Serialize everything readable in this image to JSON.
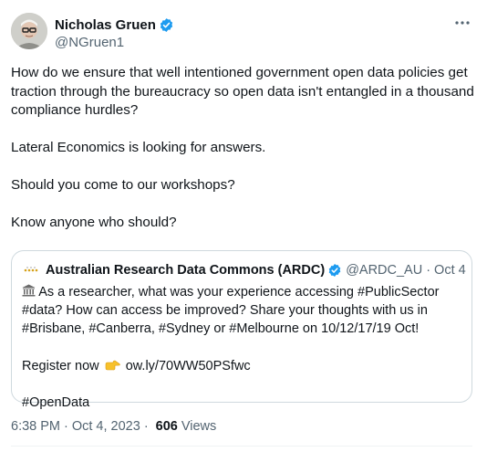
{
  "author": {
    "display_name": "Nicholas Gruen",
    "handle": "@NGruen1",
    "avatar_icon": "profile-avatar-glasses",
    "verified_icon": "verified-badge-icon"
  },
  "tweet": {
    "text": "How do we ensure that well intentioned government open data policies get traction through the bureaucracy so open data isn't entangled in a thousand compliance hurdles?\n\nLateral Economics is looking for answers.\n\nShould you come to our workshops?\n\nKnow anyone who should?"
  },
  "quote": {
    "display_name": "Australian Research Data Commons (ARDC)",
    "handle": "@ARDC_AU",
    "separator": "·",
    "date": "Oct 4",
    "body_line1": "As a researcher, what was your experience accessing #PublicSector #data? How can access be improved? Share your thoughts with us in #Brisbane, #Canberra, #Sydney or #Melbourne on 10/12/17/19 Oct!",
    "register_label": "Register now",
    "register_link": "ow.ly/70WW50PSfwc",
    "hashtag": "#OpenData"
  },
  "meta": {
    "time": "6:38 PM",
    "dot1": "·",
    "date": "Oct 4, 2023",
    "dot2": "·",
    "views_count": "606",
    "views_label": "Views"
  },
  "colors": {
    "text_primary": "#0f1419",
    "text_secondary": "#536471",
    "verified_blue": "#1d9bf0",
    "border": "#cfd9de"
  }
}
